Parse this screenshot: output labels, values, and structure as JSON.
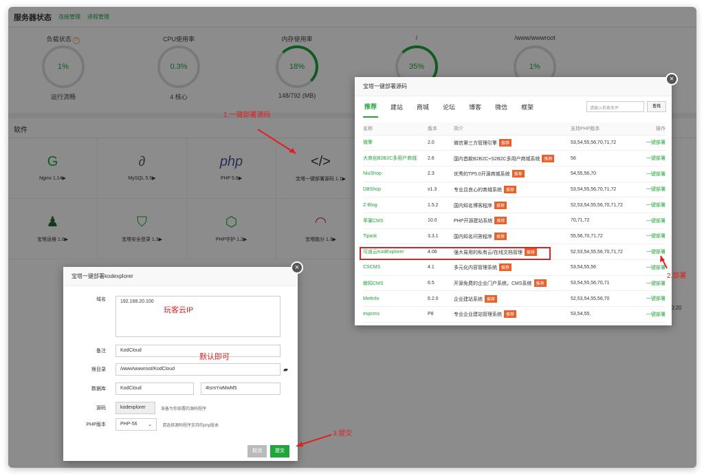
{
  "header": {
    "title": "服务器状态",
    "link1": "连接管理",
    "link2": "进程管理"
  },
  "gauges": [
    {
      "label": "负载状态",
      "value": "1%",
      "sub": "运行流畅",
      "help": "?"
    },
    {
      "label": "CPU使用率",
      "value": "0.3%",
      "sub": "4 核心"
    },
    {
      "label": "内存使用率",
      "value": "18%",
      "sub": "148/792 (MB)"
    },
    {
      "label": "/",
      "value": "35%",
      "sub": ""
    },
    {
      "label": "/www/wwwroot",
      "value": "1%",
      "sub": ""
    }
  ],
  "software": {
    "title": "软件",
    "items": [
      {
        "name": "Nginx 1.14▶",
        "icon": "nginx-icon"
      },
      {
        "name": "MySQL 5.5▶",
        "icon": "mysql-icon"
      },
      {
        "name": "PHP 5.6▶",
        "icon": "php-icon"
      },
      {
        "name": "宝塔一键部署源码 1.1▶",
        "icon": "code-icon"
      },
      {
        "name": "宝塔运维 1.0▶",
        "icon": "operator-icon"
      },
      {
        "name": "宝塔安全登录 1.3▶",
        "icon": "lock-icon"
      },
      {
        "name": "PHP守护 1.2▶",
        "icon": "php-guard-icon"
      },
      {
        "name": "宝塔跑分 1.3▶",
        "icon": "speed-icon"
      }
    ]
  },
  "annotations": {
    "a1": "1.一键部署源码",
    "a2": "2.部署",
    "a3": "3.提交",
    "ip": "玩客云IP",
    "default": "默认即可"
  },
  "deploy_modal": {
    "title": "宝塔一键部署源码",
    "tabs": [
      "推荐",
      "建站",
      "商城",
      "论坛",
      "博客",
      "微信",
      "框架"
    ],
    "search_placeholder": "请输入检索条件",
    "search_button": "查找",
    "columns": [
      "名称",
      "版本",
      "简介",
      "支持PHP版本",
      "操作"
    ],
    "badge": "推荐",
    "action": "一键部署",
    "rows": [
      {
        "name": "微擎",
        "ver": "2.0",
        "desc": "微信第三方管理引擎",
        "php": "53,54,55,56,70,71,72"
      },
      {
        "name": "大商创B2B2C多用户商城",
        "ver": "2.6",
        "desc": "国内首款B2B2C+S2B2C多用户商城系统",
        "php": "56"
      },
      {
        "name": "NiuShop",
        "ver": "2.3",
        "desc": "优秀的TP5.0开源商城系统",
        "php": "54,55,56,70"
      },
      {
        "name": "DBShop",
        "ver": "v1.3",
        "desc": "专业且良心的商城系统",
        "php": "53,54,55,56,70,71,72"
      },
      {
        "name": "Z-Blog",
        "ver": "1.5.2",
        "desc": "国内知名博客程序",
        "php": "52,53,54,55,56,70,71,72"
      },
      {
        "name": "苹果CMS",
        "ver": "10.0",
        "desc": "PHP开源建站系统",
        "php": "70,71,72"
      },
      {
        "name": "Tipask",
        "ver": "3.3.1",
        "desc": "国内知名问答程序",
        "php": "55,56,70,71,72"
      },
      {
        "name": "可道云KodExplorer",
        "ver": "4.06",
        "desc": "强大易用的私有云/在线文档管理",
        "php": "52,53,54,55,56,70,71,72"
      },
      {
        "name": "CSCMS",
        "ver": "4.1",
        "desc": "多元化内容管理系统",
        "php": "53,54,55,56"
      },
      {
        "name": "蝉知CMS",
        "ver": "6.5",
        "desc": "开源免费的企业门户系统，CMS系统",
        "php": "53,54,55,56,70,71"
      },
      {
        "name": "MetInfo",
        "ver": "6.2.0",
        "desc": "企业建站系统",
        "php": "52,53,54,55,56,70"
      },
      {
        "name": "espcms",
        "ver": "P8",
        "desc": "专业企业建站管理系统",
        "php": "53,54,55,"
      }
    ]
  },
  "kod_modal": {
    "title": "宝塔一键部署kodexplorer",
    "domain_label": "域名",
    "domain_value": "192.168.20.100",
    "note_label": "备注",
    "note_value": "KodCloud",
    "root_label": "根目录",
    "root_value": "/www/wwwroot/KodCloud",
    "db_label": "数据库",
    "db_name": "KodCloud",
    "db_pass": "4tsmYwMwM5",
    "src_label": "源码",
    "src_value": "kodexplorer",
    "src_hint": "准备为你部署的源码程序",
    "php_label": "PHP版本",
    "php_value": "PHP-56",
    "php_hint": "请选择源码程序支持的php版本",
    "cancel": "取消",
    "submit": "提交"
  },
  "clock_fragment": "0:20",
  "colors": {
    "accent": "#20a53a",
    "annotation": "#e02020",
    "badge": "#e8602a"
  }
}
